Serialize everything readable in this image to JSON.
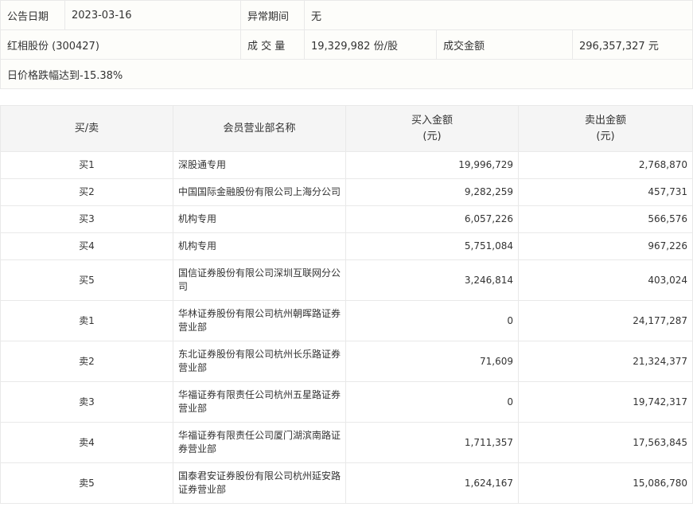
{
  "info": {
    "date_label": "公告日期",
    "date": "2023-03-16",
    "period_label": "异常期间",
    "period": "无",
    "stock": "红相股份 (300427)",
    "volume_label": "成 交 量",
    "volume": "19,329,982 份/股",
    "amount_label": "成交金额",
    "amount": "296,357,327 元",
    "reason": "日价格跌幅达到-15.38%"
  },
  "table": {
    "headers": {
      "side": "买/卖",
      "name": "会员营业部名称",
      "buy": "买入金额",
      "buy_unit": "(元)",
      "sell": "卖出金额",
      "sell_unit": "(元)"
    },
    "rows": [
      {
        "side": "买1",
        "name": "深股通专用",
        "buy": "19,996,729",
        "sell": "2,768,870"
      },
      {
        "side": "买2",
        "name": "中国国际金融股份有限公司上海分公司",
        "buy": "9,282,259",
        "sell": "457,731"
      },
      {
        "side": "买3",
        "name": "机构专用",
        "buy": "6,057,226",
        "sell": "566,576"
      },
      {
        "side": "买4",
        "name": "机构专用",
        "buy": "5,751,084",
        "sell": "967,226"
      },
      {
        "side": "买5",
        "name": "国信证券股份有限公司深圳互联网分公司",
        "buy": "3,246,814",
        "sell": "403,024"
      },
      {
        "side": "卖1",
        "name": "华林证券股份有限公司杭州朝晖路证券营业部",
        "buy": "0",
        "sell": "24,177,287"
      },
      {
        "side": "卖2",
        "name": "东北证券股份有限公司杭州长乐路证券营业部",
        "buy": "71,609",
        "sell": "21,324,377"
      },
      {
        "side": "卖3",
        "name": "华福证券有限责任公司杭州五星路证券营业部",
        "buy": "0",
        "sell": "19,742,317"
      },
      {
        "side": "卖4",
        "name": "华福证券有限责任公司厦门湖滨南路证券营业部",
        "buy": "1,711,357",
        "sell": "17,563,845"
      },
      {
        "side": "卖5",
        "name": "国泰君安证券股份有限公司杭州延安路证券营业部",
        "buy": "1,624,167",
        "sell": "15,086,780"
      }
    ]
  }
}
